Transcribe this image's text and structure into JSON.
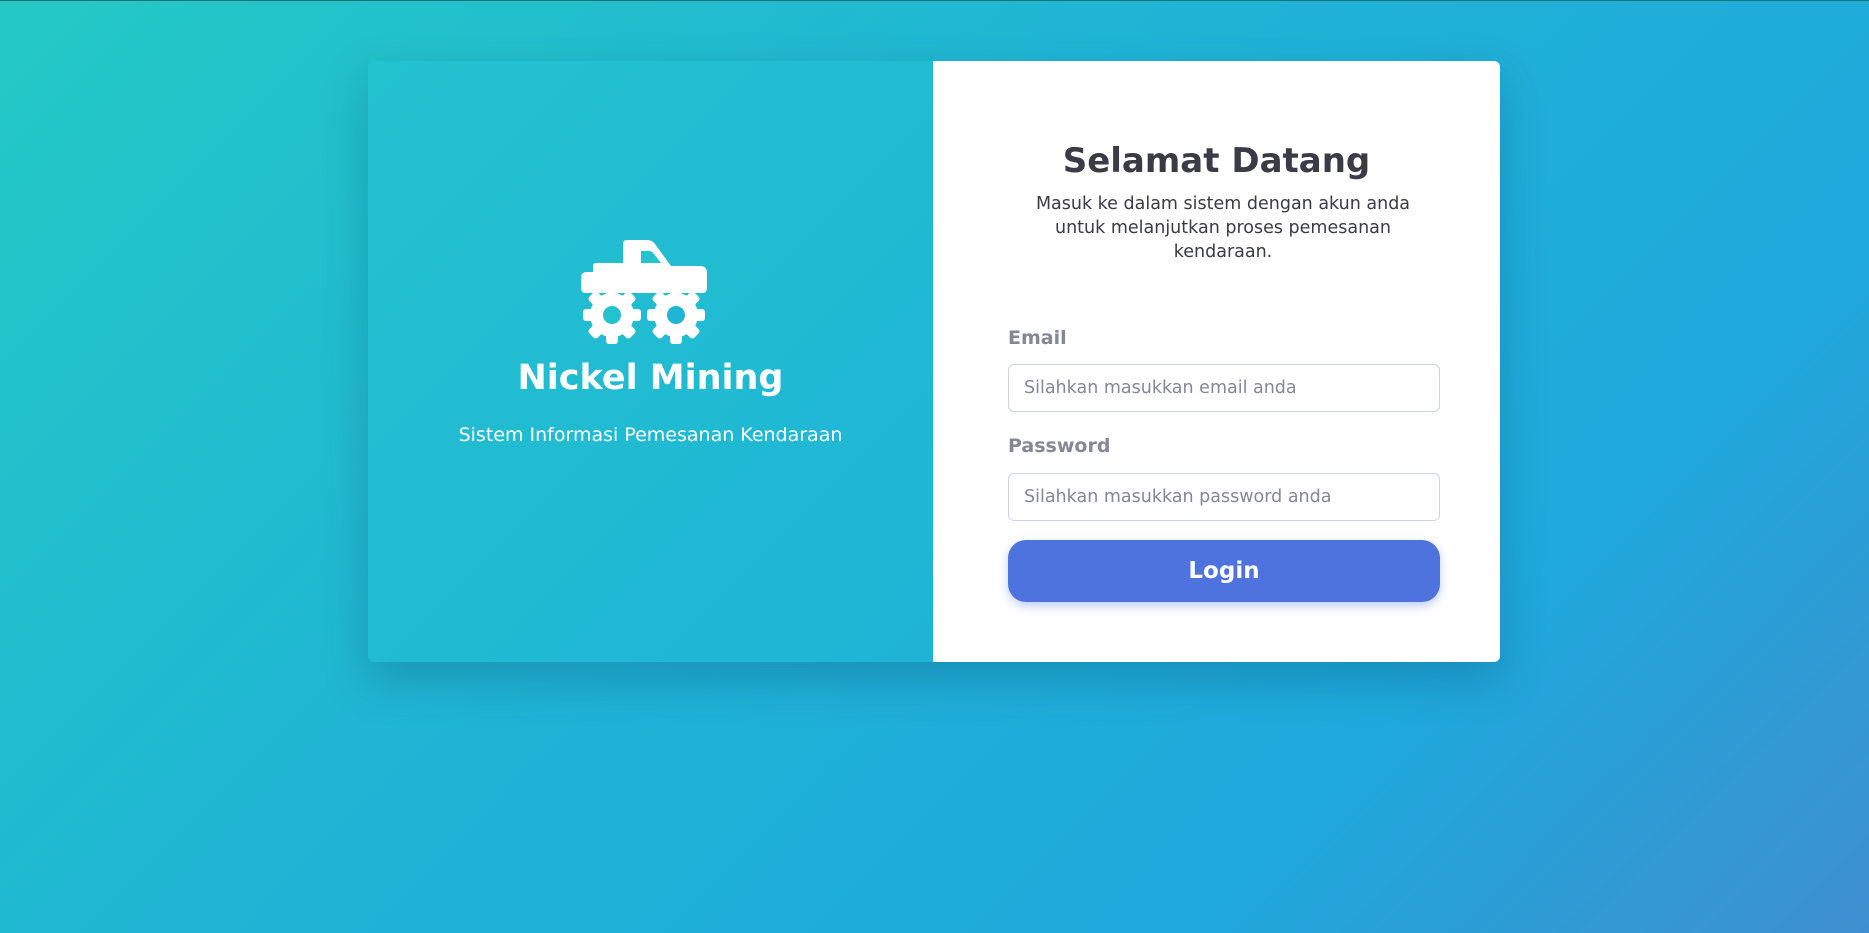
{
  "brand": {
    "icon": "monster-truck-icon",
    "title": "Nickel Mining",
    "subtitle": "Sistem Informasi Pemesanan Kendaraan"
  },
  "login": {
    "title": "Selamat Datang",
    "description": "Masuk ke dalam sistem dengan akun anda untuk melanjutkan proses pemesanan kendaraan.",
    "email_label": "Email",
    "email_placeholder": "Silahkan masukkan email anda",
    "email_value": "",
    "password_label": "Password",
    "password_placeholder": "Silahkan masukkan password anda",
    "password_value": "",
    "button_label": "Login"
  },
  "colors": {
    "background_start": "#24c9c5",
    "background_end": "#1ea9dc",
    "panel_accent": "#23c2cf",
    "primary_button": "#4e73df",
    "heading_text": "#3a3b45",
    "label_text": "#858796"
  }
}
